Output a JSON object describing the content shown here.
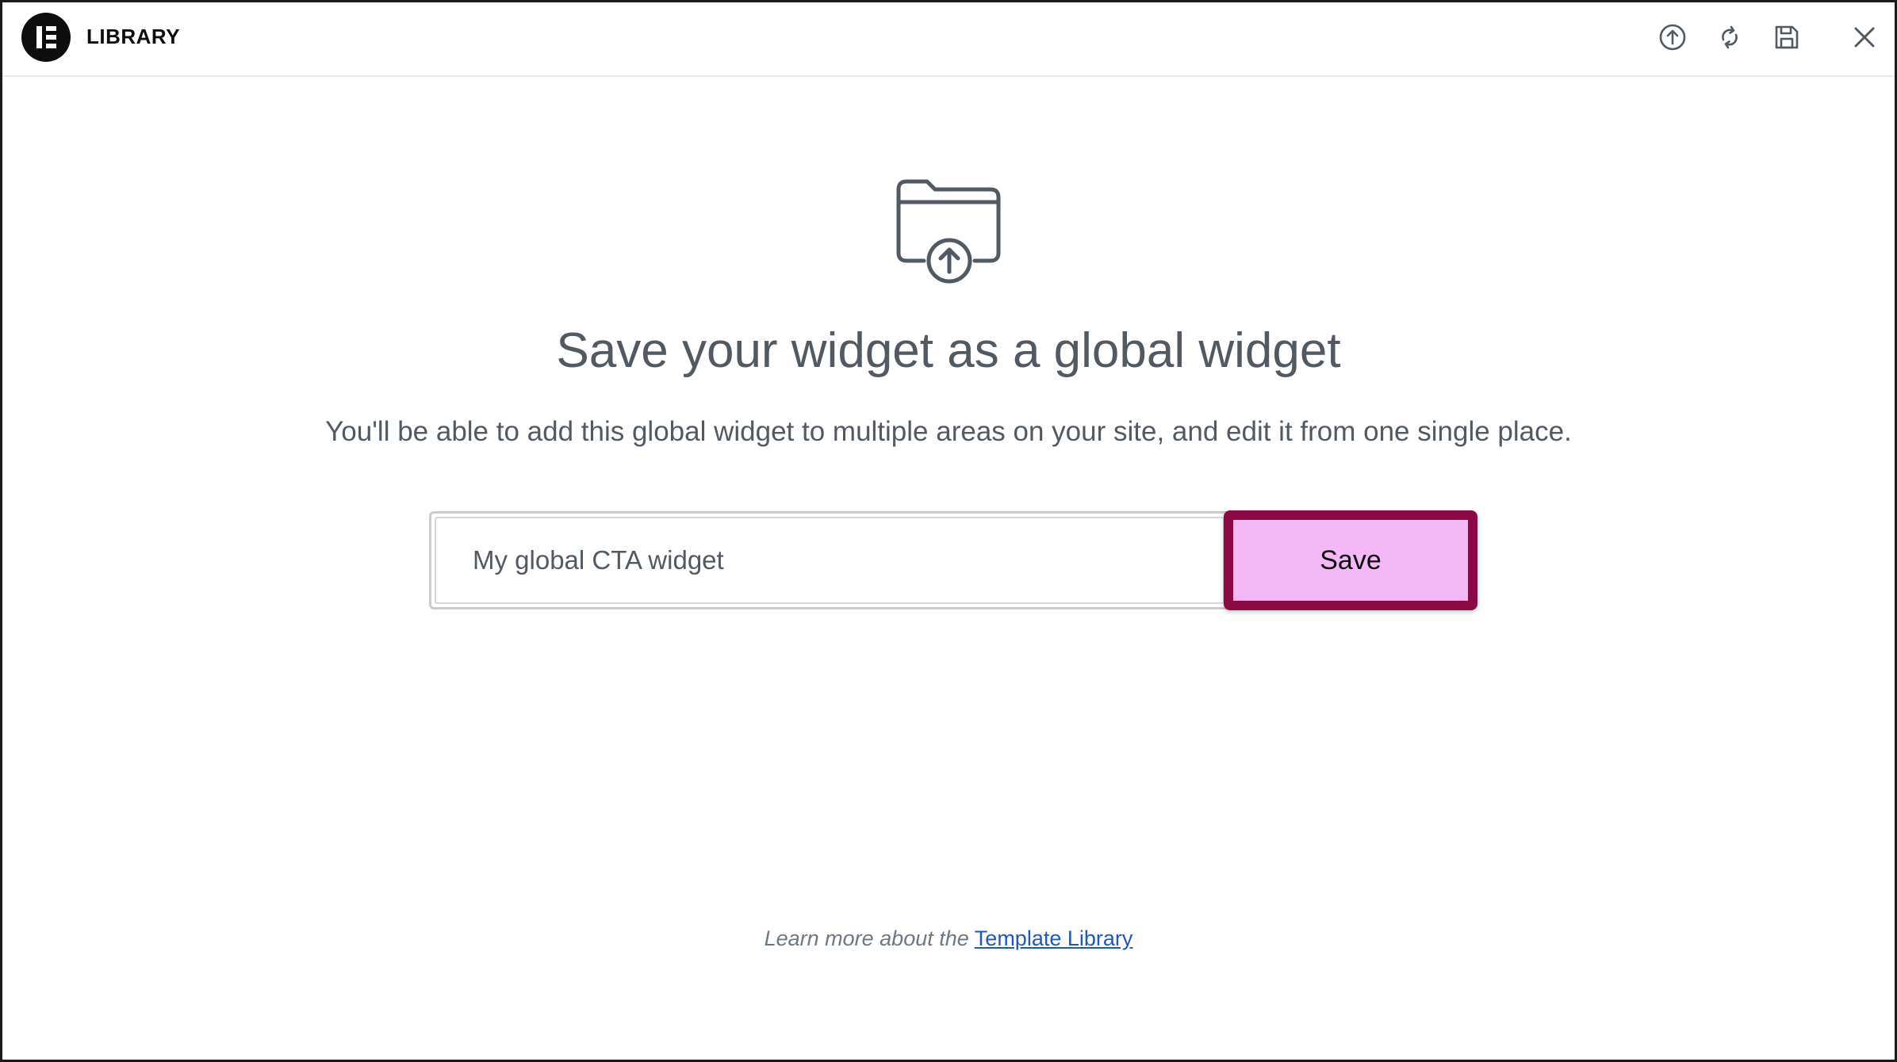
{
  "header": {
    "title": "LIBRARY",
    "actions": [
      {
        "name": "upload-icon"
      },
      {
        "name": "sync-icon"
      },
      {
        "name": "save-icon"
      },
      {
        "name": "close-icon"
      }
    ]
  },
  "main": {
    "icon": "folder-upload-icon",
    "heading": "Save your widget as a global widget",
    "subtext": "You'll be able to add this global widget to multiple areas on your site, and edit it from one single place.",
    "name_input": {
      "value": "My global CTA widget",
      "placeholder": ""
    },
    "save_label": "Save"
  },
  "footer": {
    "lead_text": "Learn more about the",
    "link_text": "Template Library"
  },
  "colors": {
    "save_button_fill": "#f3b8f5",
    "save_button_border": "#8b0a43",
    "link": "#1d56c5",
    "text": "#515962"
  }
}
